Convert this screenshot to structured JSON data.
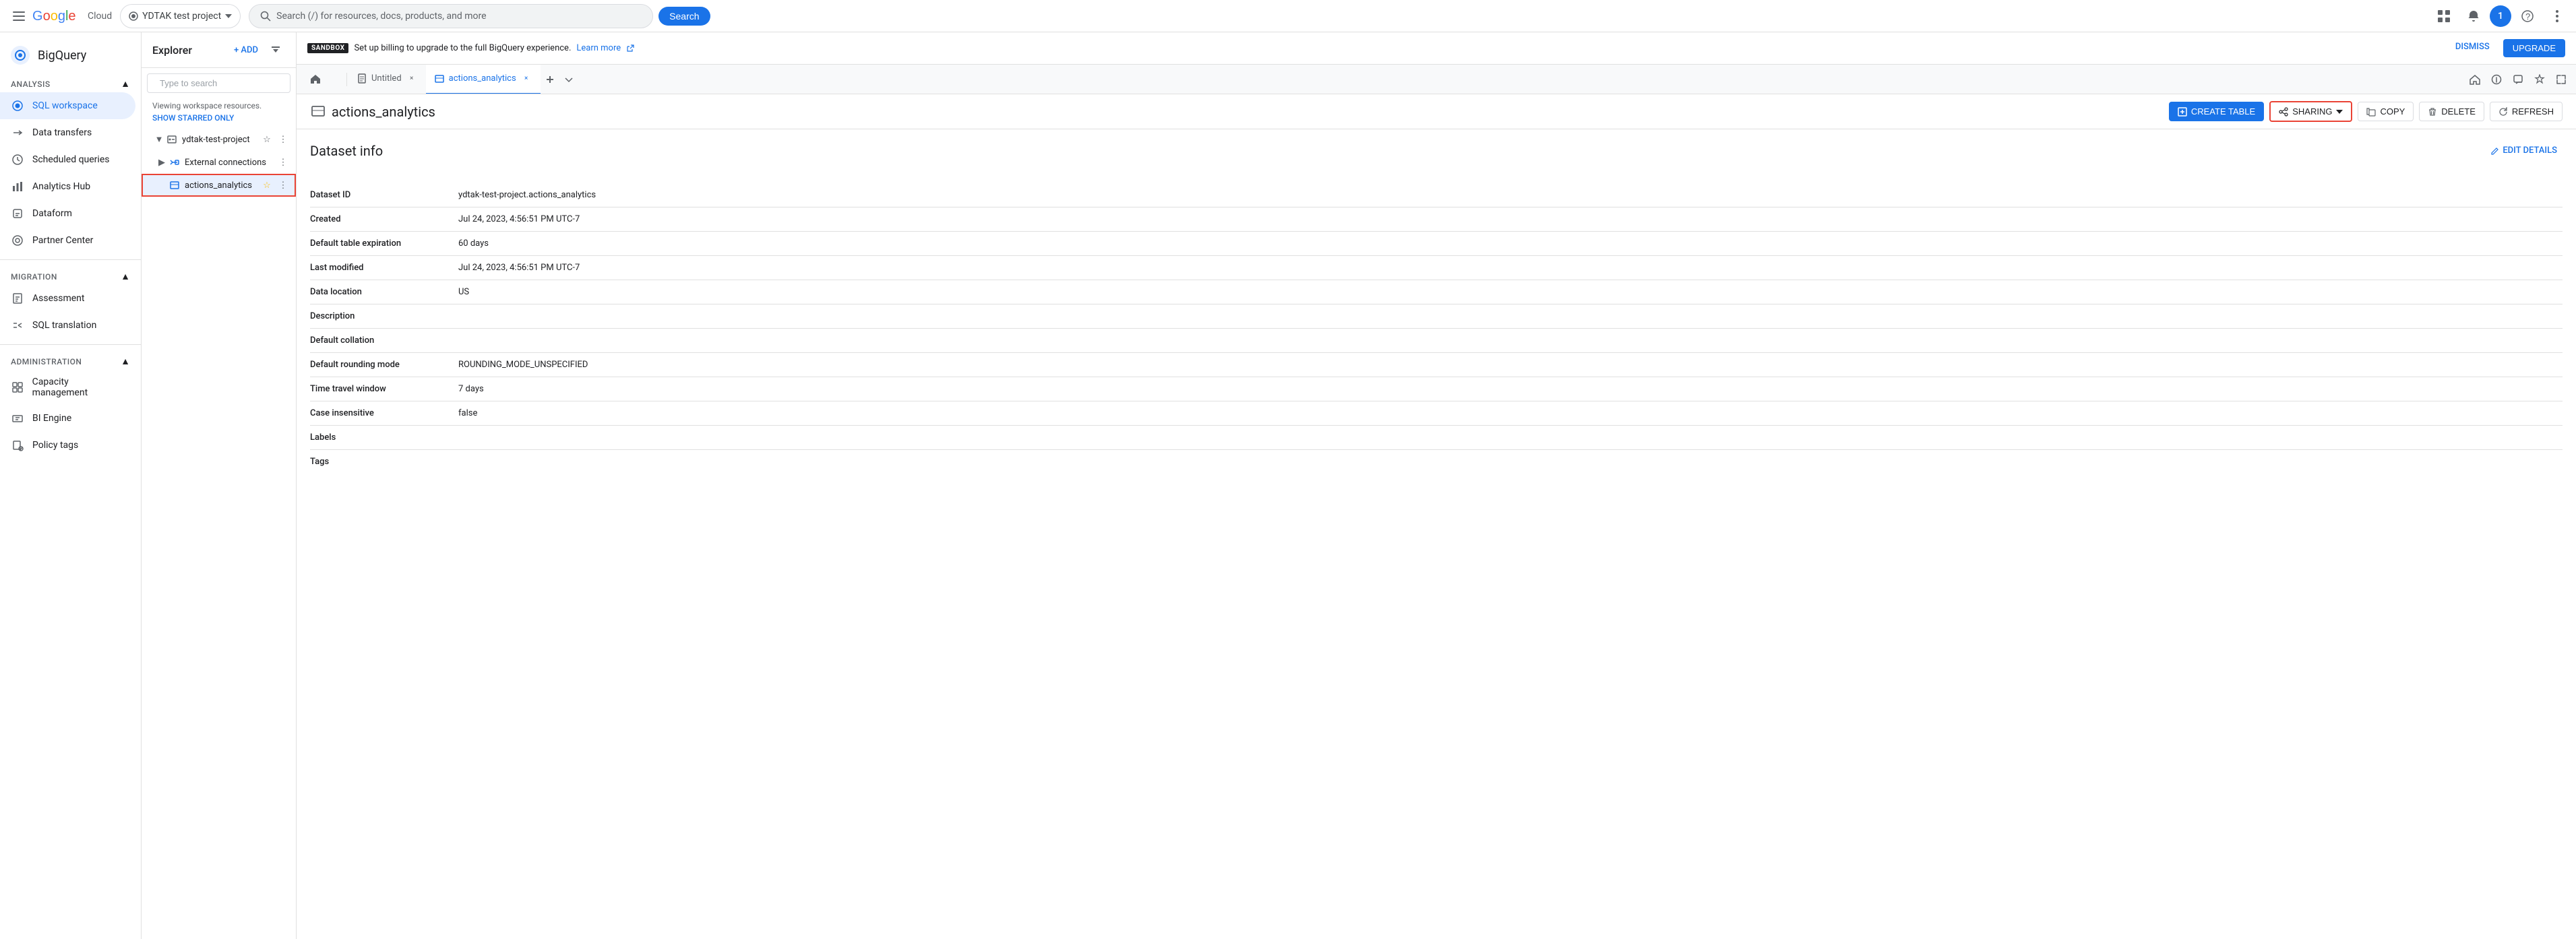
{
  "topbar": {
    "menu_label": "Main menu",
    "logo_text": "Google",
    "cloud_text": "Cloud",
    "project_name": "YDTAK test project",
    "search_placeholder": "Search (/) for resources, docs, products, and more",
    "search_btn": "Search",
    "icons": [
      "apps",
      "notifications",
      "user",
      "help",
      "more"
    ]
  },
  "sidebar": {
    "product_name": "BigQuery",
    "sections": [
      {
        "label": "Analysis",
        "items": [
          {
            "id": "sql-workspace",
            "label": "SQL workspace",
            "active": true
          },
          {
            "id": "data-transfers",
            "label": "Data transfers"
          },
          {
            "id": "scheduled-queries",
            "label": "Scheduled queries"
          },
          {
            "id": "analytics-hub",
            "label": "Analytics Hub"
          },
          {
            "id": "dataform",
            "label": "Dataform"
          },
          {
            "id": "partner-center",
            "label": "Partner Center"
          }
        ]
      },
      {
        "label": "Migration",
        "items": [
          {
            "id": "assessment",
            "label": "Assessment"
          },
          {
            "id": "sql-translation",
            "label": "SQL translation"
          }
        ]
      },
      {
        "label": "Administration",
        "items": [
          {
            "id": "capacity-management",
            "label": "Capacity management"
          },
          {
            "id": "bi-engine",
            "label": "BI Engine"
          },
          {
            "id": "policy-tags",
            "label": "Policy tags"
          }
        ]
      }
    ]
  },
  "explorer": {
    "title": "Explorer",
    "add_btn": "+ ADD",
    "search_placeholder": "Type to search",
    "hint": "Viewing workspace resources.",
    "show_starred": "SHOW STARRED ONLY",
    "project_name": "ydtak-test-project",
    "tree_items": [
      {
        "id": "external-connections",
        "label": "External connections",
        "indent": 1,
        "has_expand": true
      },
      {
        "id": "actions-analytics",
        "label": "actions_analytics",
        "indent": 1,
        "selected": true,
        "highlighted": true
      }
    ]
  },
  "tabs": [
    {
      "id": "home",
      "label": "",
      "icon": "home",
      "active": false,
      "closeable": false
    },
    {
      "id": "untitled",
      "label": "Untitled",
      "icon": "query",
      "active": false,
      "closeable": true
    },
    {
      "id": "actions-analytics",
      "label": "actions_analytics",
      "icon": "dataset",
      "active": true,
      "closeable": true
    }
  ],
  "sandbox_banner": {
    "badge": "SANDBOX",
    "message": "Set up billing to upgrade to the full BigQuery experience.",
    "link_text": "Learn more",
    "dismiss": "DISMISS",
    "upgrade": "UPGRADE"
  },
  "dataset": {
    "title": "actions_analytics",
    "actions": {
      "create_table": "CREATE TABLE",
      "sharing": "SHARING",
      "copy": "COPY",
      "delete": "DELETE",
      "refresh": "REFRESH",
      "edit_details": "EDIT DETAILS"
    },
    "info_title": "Dataset info",
    "fields": [
      {
        "label": "Dataset ID",
        "value": "ydtak-test-project.actions_analytics"
      },
      {
        "label": "Created",
        "value": "Jul 24, 2023, 4:56:51 PM UTC-7"
      },
      {
        "label": "Default table expiration",
        "value": "60 days"
      },
      {
        "label": "Last modified",
        "value": "Jul 24, 2023, 4:56:51 PM UTC-7"
      },
      {
        "label": "Data location",
        "value": "US"
      },
      {
        "label": "Description",
        "value": ""
      },
      {
        "label": "Default collation",
        "value": ""
      },
      {
        "label": "Default rounding mode",
        "value": "ROUNDING_MODE_UNSPECIFIED"
      },
      {
        "label": "Time travel window",
        "value": "7 days"
      },
      {
        "label": "Case insensitive",
        "value": "false"
      },
      {
        "label": "Labels",
        "value": ""
      },
      {
        "label": "Tags",
        "value": ""
      }
    ]
  }
}
